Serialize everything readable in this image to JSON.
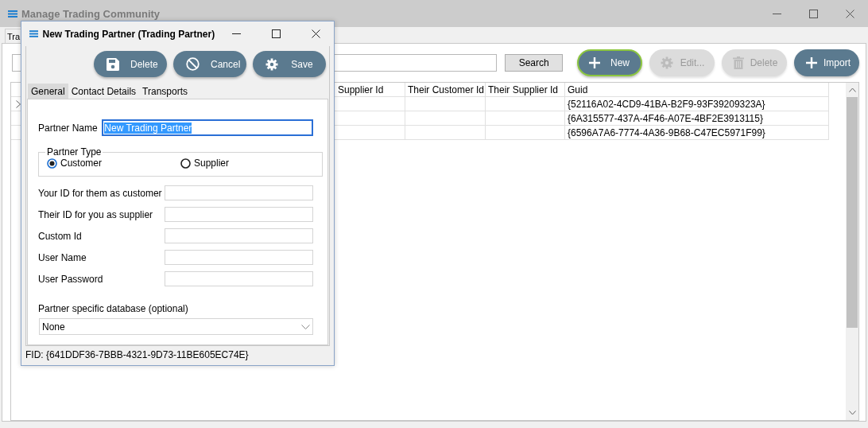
{
  "main_window": {
    "title": "Manage Trading Community",
    "tabs": [
      {
        "label": "Tra",
        "selected": true
      }
    ],
    "search": {
      "button": "Search"
    },
    "toolbar": [
      {
        "kind": "plus",
        "label": "New",
        "disabled": false,
        "focused": true
      },
      {
        "kind": "gear",
        "label": "Edit...",
        "disabled": true,
        "focused": false
      },
      {
        "kind": "trash",
        "label": "Delete",
        "disabled": true,
        "focused": false
      },
      {
        "kind": "plus",
        "label": "Import",
        "disabled": false,
        "focused": false
      }
    ],
    "table": {
      "columns": [
        "Supplier Id",
        "Their Customer Id",
        "Their Supplier Id",
        "Guid"
      ],
      "rows": [
        {
          "current": true,
          "cells": [
            "",
            "",
            "",
            "{52116A02-4CD9-41BA-B2F9-93F39209323A}"
          ]
        },
        {
          "current": false,
          "cells": [
            "",
            "",
            "",
            "{6A315577-437A-4F46-A07E-4BF2E3913115}"
          ]
        },
        {
          "current": false,
          "cells": [
            "",
            "",
            "",
            "{6596A7A6-7774-4A36-9B68-C47EC5971F99}"
          ]
        }
      ]
    }
  },
  "dialog": {
    "title": "New Trading Partner (Trading Partner)",
    "toolbar": [
      {
        "kind": "floppy",
        "label": "Delete"
      },
      {
        "kind": "ban",
        "label": "Cancel"
      },
      {
        "kind": "gear",
        "label": "Save"
      }
    ],
    "tabs": [
      {
        "label": "General",
        "selected": true
      },
      {
        "label": "Contact Details",
        "selected": false
      },
      {
        "label": "Transports",
        "selected": false
      }
    ],
    "partner_name": {
      "label": "Partner Name",
      "value": "New Trading Partner",
      "focused": true
    },
    "partner_type": {
      "legend": "Partner Type",
      "options": [
        {
          "label": "Customer",
          "selected": true
        },
        {
          "label": "Supplier",
          "selected": false
        }
      ]
    },
    "fields": [
      {
        "label": "Your ID for them as customer"
      },
      {
        "label": "Their ID for you as supplier"
      },
      {
        "label": "Custom Id"
      },
      {
        "label": "User Name"
      },
      {
        "label": "User Password"
      }
    ],
    "database": {
      "label": "Partner specific database (optional)",
      "value": "None"
    },
    "fid": "FID: {641DDF36-7BBB-4321-9D73-11BE605EC74E}"
  }
}
